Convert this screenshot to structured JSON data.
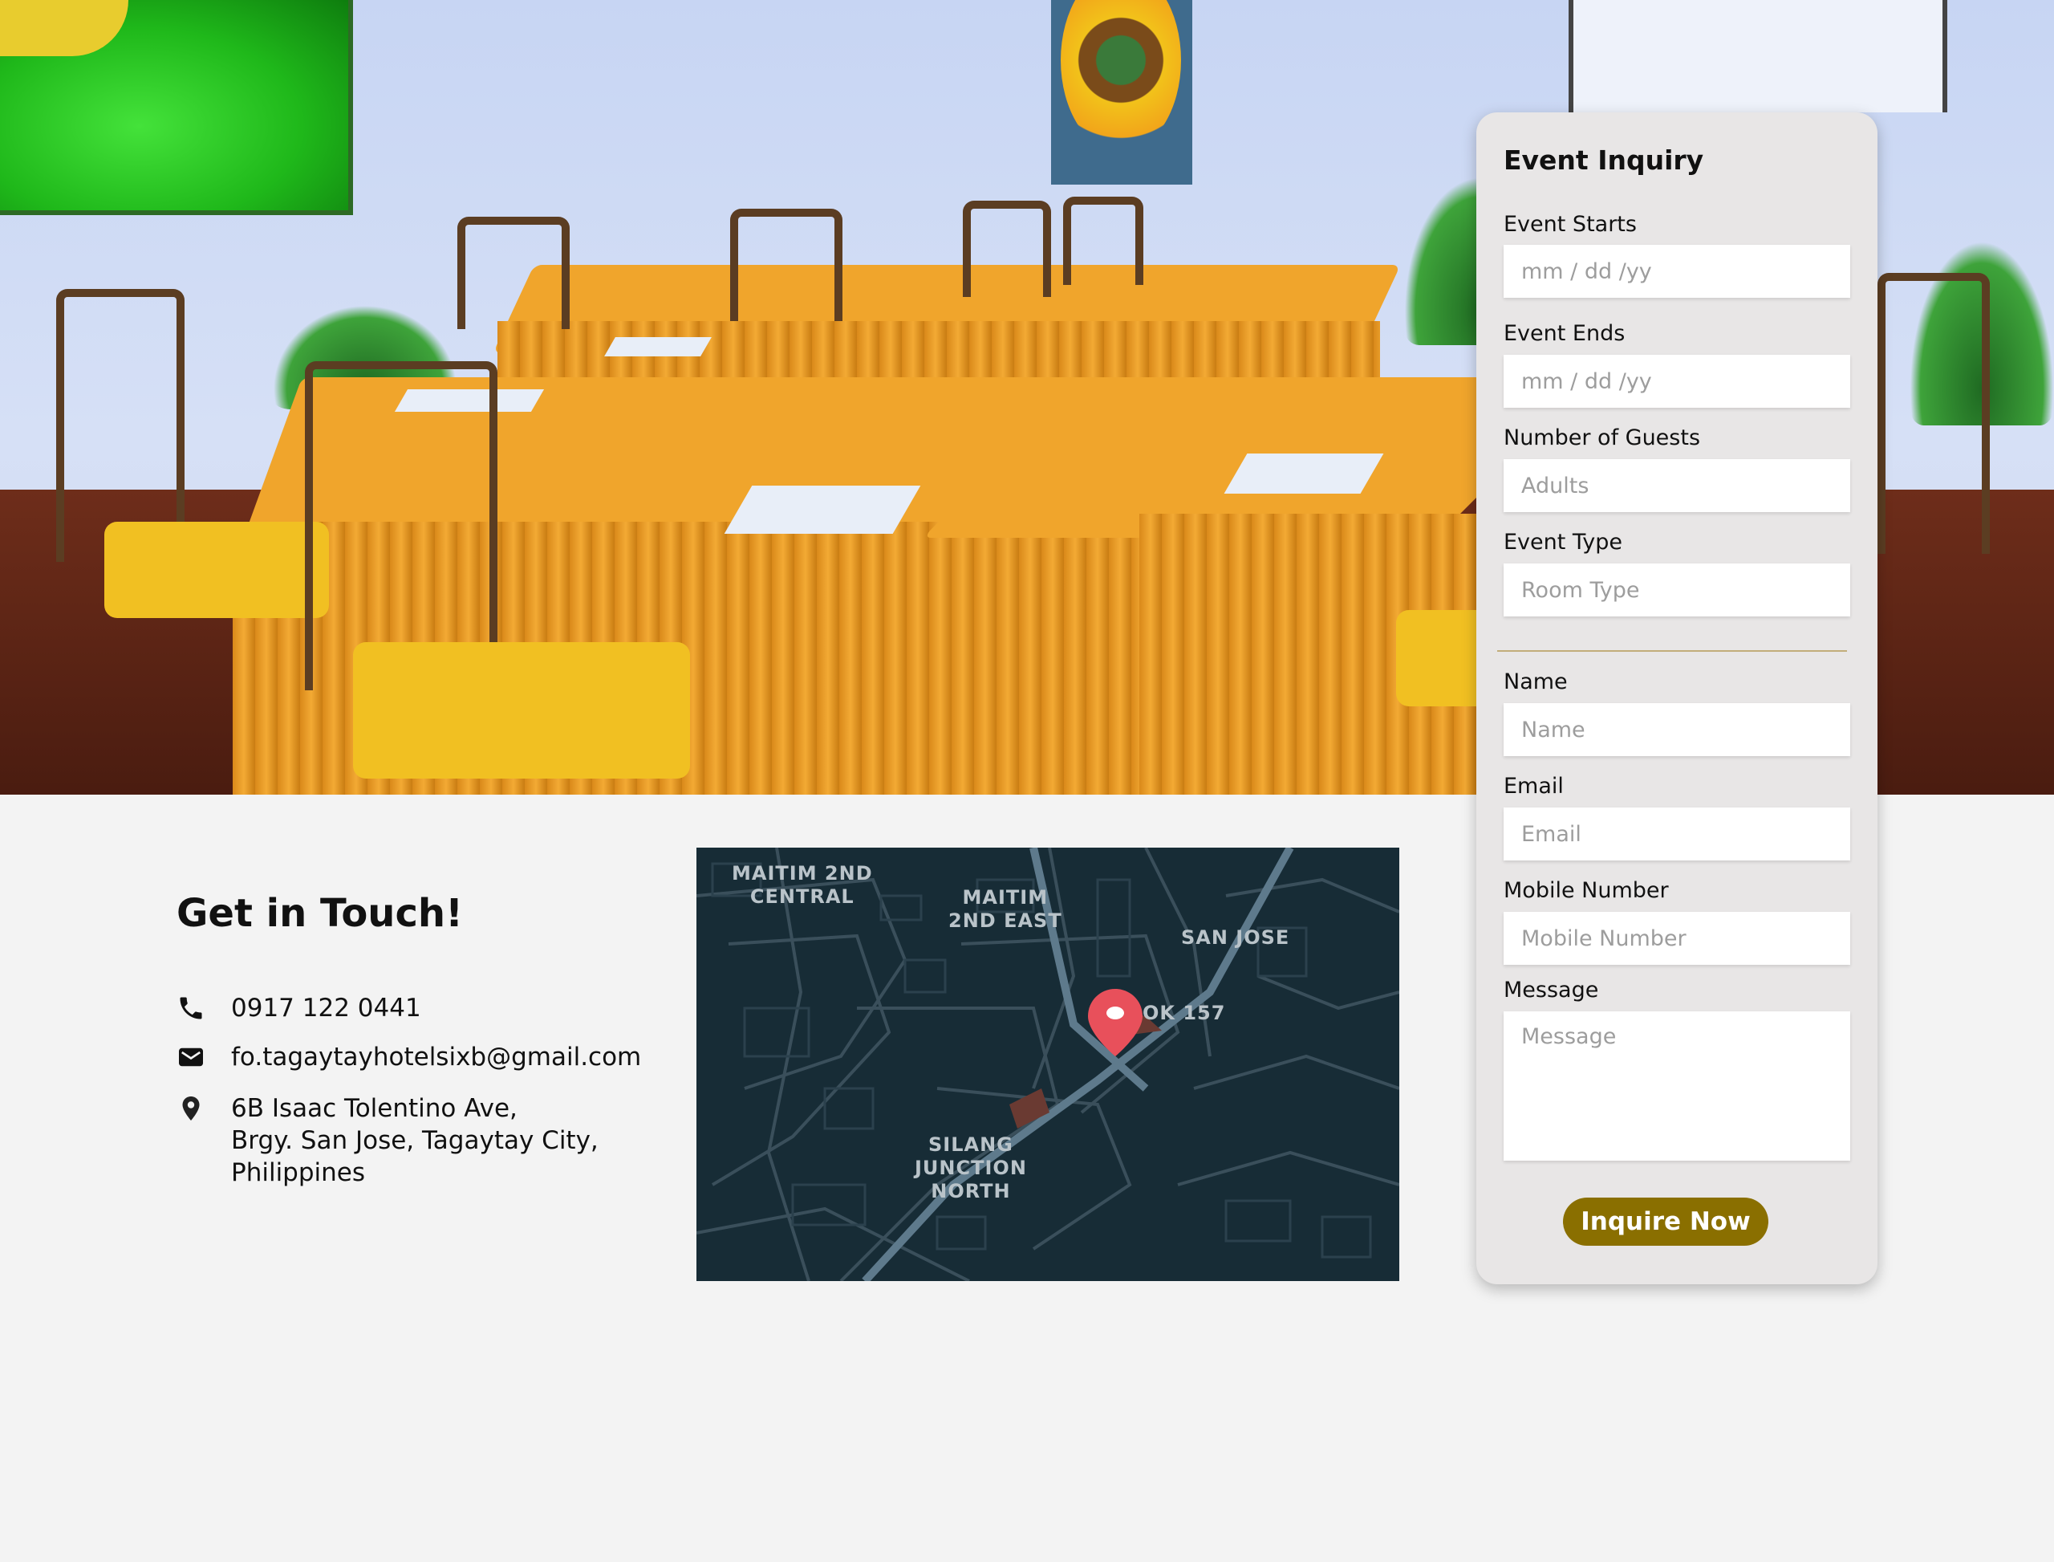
{
  "contact": {
    "heading": "Get in Touch!",
    "phone": "0917 122 0441",
    "email": "fo.tagaytayhotelsixb@gmail.com",
    "address_lines": [
      "6B Isaac Tolentino Ave,",
      "Brgy. San Jose, Tagaytay City,",
      "Philippines"
    ],
    "icons": [
      "phone-icon",
      "mail-icon",
      "location-pin-icon"
    ]
  },
  "map": {
    "labels": {
      "maitim_central": [
        "MAITIM 2ND",
        "CENTRAL"
      ],
      "maitim_east": [
        "MAITIM",
        "2ND EAST"
      ],
      "san_jose": "SAN JOSE",
      "purok": "OK 157",
      "silang": [
        "SILANG",
        "JUNCTION",
        "NORTH"
      ]
    },
    "pin_color": "#e8505b"
  },
  "form": {
    "title": "Event Inquiry",
    "event_starts_label": "Event Starts",
    "event_starts_placeholder": "mm / dd /yy",
    "event_ends_label": "Event Ends",
    "event_ends_placeholder": "mm / dd /yy",
    "guests_label": "Number of Guests",
    "guests_placeholder": "Adults",
    "event_type_label": "Event Type",
    "event_type_placeholder": "Room Type",
    "name_label": "Name",
    "name_placeholder": "Name",
    "email_label": "Email",
    "email_placeholder": "Email",
    "mobile_label": "Mobile Number",
    "mobile_placeholder": "Mobile Number",
    "message_label": "Message",
    "message_placeholder": "Message",
    "submit_label": "Inquire Now"
  },
  "colors": {
    "accent": "#8a6f00",
    "divider": "#c2ad7a",
    "page_background": "#f3f3f3",
    "form_background": "#e8e6e6",
    "map_background": "#172c36"
  }
}
